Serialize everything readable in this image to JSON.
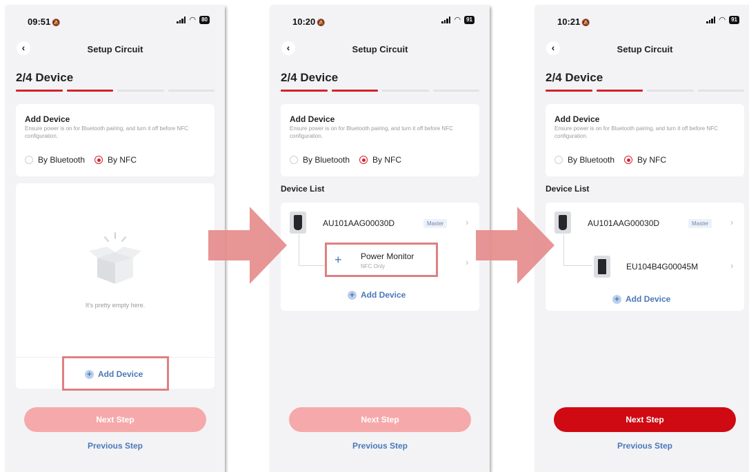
{
  "colors": {
    "accent_red": "#d6212b",
    "button_disabled": "#f6a9aa",
    "button_enabled": "#cf0a12",
    "link_blue": "#4a78b8",
    "highlight": "#e07f80",
    "flow_arrow": "#e58c8c"
  },
  "screens": [
    {
      "status": {
        "time": "09:51",
        "battery": "80"
      },
      "nav": {
        "title": "Setup Circuit",
        "back_icon": "chevron-left-icon"
      },
      "step": {
        "title": "2/4 Device",
        "active_segments": 2,
        "total_segments": 4
      },
      "method_card": {
        "title": "Add Device",
        "description": "Ensure power is on for Bluetooth pairing, and turn it off before NFC configuration.",
        "options": [
          {
            "label": "By Bluetooth",
            "checked": false
          },
          {
            "label": "By NFC",
            "checked": true
          }
        ]
      },
      "empty_state": {
        "icon": "empty-box-icon",
        "text": "It's pretty empty here."
      },
      "add_device_label": "Add Device",
      "next_label": "Next Step",
      "next_enabled": false,
      "previous_label": "Previous Step"
    },
    {
      "status": {
        "time": "10:20",
        "battery": "91"
      },
      "nav": {
        "title": "Setup Circuit",
        "back_icon": "chevron-left-icon"
      },
      "step": {
        "title": "2/4 Device",
        "active_segments": 2,
        "total_segments": 4
      },
      "method_card": {
        "title": "Add Device",
        "description": "Ensure power is on for Bluetooth pairing, and turn it off before NFC configuration.",
        "options": [
          {
            "label": "By Bluetooth",
            "checked": false
          },
          {
            "label": "By NFC",
            "checked": true
          }
        ]
      },
      "device_list": {
        "title": "Device List",
        "master": {
          "name": "AU101AAG00030D",
          "badge": "Master"
        },
        "child": {
          "name": "Power Monitor",
          "subtitle": "NFC Only",
          "icon": "plus-icon"
        }
      },
      "add_device_label": "Add Device",
      "next_label": "Next Step",
      "next_enabled": false,
      "previous_label": "Previous Step"
    },
    {
      "status": {
        "time": "10:21",
        "battery": "91"
      },
      "nav": {
        "title": "Setup Circuit",
        "back_icon": "chevron-left-icon"
      },
      "step": {
        "title": "2/4 Device",
        "active_segments": 2,
        "total_segments": 4
      },
      "method_card": {
        "title": "Add Device",
        "description": "Ensure power is on for Bluetooth pairing, and turn it off before NFC configuration.",
        "options": [
          {
            "label": "By Bluetooth",
            "checked": false
          },
          {
            "label": "By NFC",
            "checked": true
          }
        ]
      },
      "device_list": {
        "title": "Device List",
        "master": {
          "name": "AU101AAG00030D",
          "badge": "Master"
        },
        "child": {
          "name": "EU104B4G00045M"
        }
      },
      "add_device_label": "Add Device",
      "next_label": "Next Step",
      "next_enabled": true,
      "previous_label": "Previous Step"
    }
  ]
}
